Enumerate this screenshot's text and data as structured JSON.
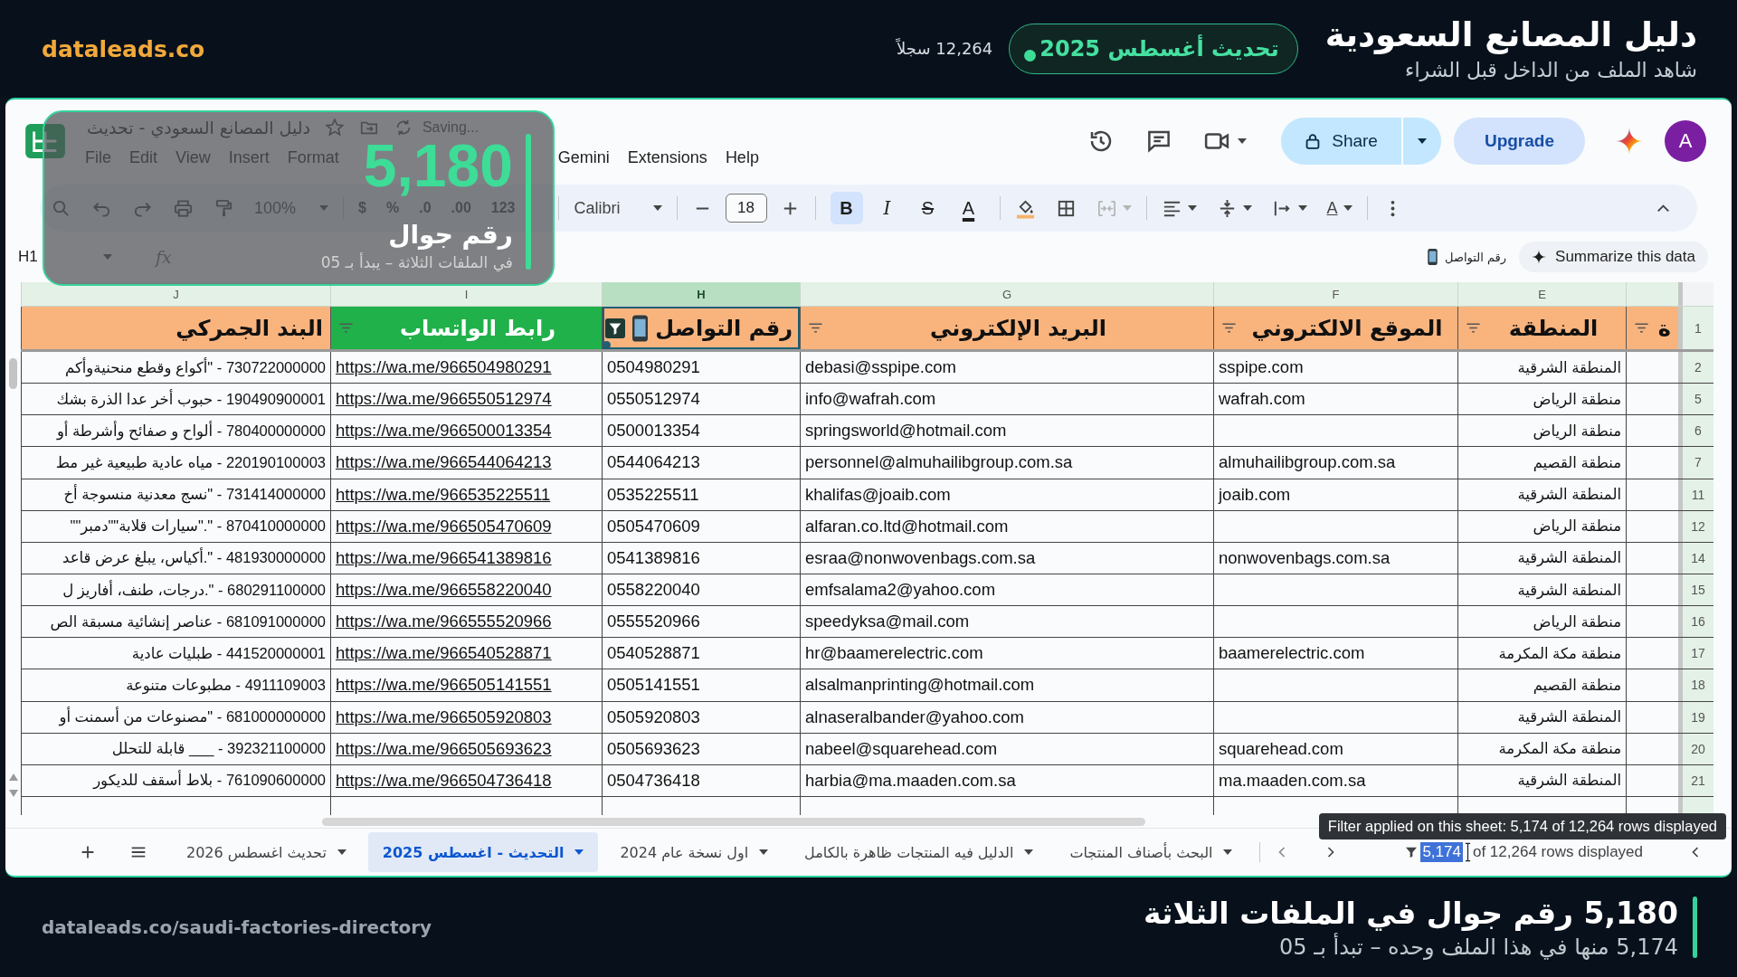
{
  "banner": {
    "brand": "dataleads.co",
    "records": "12,264 سجلاً",
    "badge": "تحديث أغسطس 2025",
    "title": "دليل المصانع السعودية",
    "subtitle": "شاهد الملف من الداخل قبل الشراء"
  },
  "overlay": {
    "number": "5,180",
    "label": "رقم جوال",
    "note": "في الملفات الثلاثة – يبدأ بـ 05"
  },
  "sheet": {
    "title": "دليل المصانع السعودي - تحديث",
    "status": "Saving...",
    "menu": [
      "Help",
      "Extensions",
      "Gemini",
      "Format",
      "Insert",
      "View",
      "Edit",
      "File"
    ],
    "share": "Share",
    "upgrade": "Upgrade",
    "avatar": "A",
    "toolbar": {
      "zoom": "100%",
      "number_formats": [
        "123",
        ".00",
        ".0",
        "%",
        "$"
      ],
      "font": "Calibri",
      "font_size": "18",
      "styles": [
        {
          "kind": "italic",
          "label": "I",
          "selected": false
        },
        {
          "kind": "bold",
          "label": "B",
          "selected": true
        }
      ],
      "strikethrough": "S",
      "text_color": "A",
      "merge_disabled": true,
      "rotation": "A"
    },
    "formula_bar": {
      "name_box": "H1",
      "fx": "fx",
      "value": "رقم التواصل",
      "summarize": "Summarize this data"
    },
    "grid": {
      "header_row": "1",
      "columns": [
        {
          "kind": "partial",
          "header": "ة",
          "filter": true,
          "filtered": false,
          "color": "#f9b47e",
          "selected": false
        },
        {
          "letter": "E",
          "kind": "region",
          "header": "المنطقة",
          "filter": true,
          "filtered": false,
          "color": "#f9b47e",
          "selected": false
        },
        {
          "letter": "F",
          "kind": "website",
          "header": "الموقع الالكتروني",
          "filter": true,
          "filtered": false,
          "color": "#f9b47e",
          "selected": false
        },
        {
          "letter": "G",
          "kind": "email",
          "header": "البريد الإلكتروني",
          "filter": true,
          "filtered": false,
          "color": "#f9b47e",
          "selected": false
        },
        {
          "letter": "H",
          "kind": "phone",
          "header": "رقم التواصل",
          "filter": true,
          "filtered": true,
          "color": "#f9b47e",
          "selected": true
        },
        {
          "letter": "I",
          "kind": "whatsapp",
          "header": "رابط الواتساب",
          "filter": true,
          "filtered": false,
          "color": "#21b14b",
          "selected": false
        },
        {
          "letter": "J",
          "kind": "tariff",
          "header": "البند الجمركي",
          "filter": false,
          "color": "#f9b47e",
          "selected": false
        }
      ],
      "rows": [
        {
          "number": "2",
          "region": "المنطقة الشرقية",
          "website": "sspipe.com",
          "email": "debasi@sspipe.com",
          "phone": "0504980291",
          "whatsapp": "https://wa.me/966504980291",
          "tariff": "730722000000 - \"أكواع وقطع منحنيةوأكم"
        },
        {
          "number": "5",
          "region": "منطقة الرياض",
          "website": "wafrah.com",
          "email": "info@wafrah.com",
          "phone": "0550512974",
          "whatsapp": "https://wa.me/966550512974",
          "tariff": "190490900001 - حبوب أخر عدا الذرة بشك"
        },
        {
          "number": "6",
          "region": "منطقة الرياض",
          "email": "springsworld@hotmail.com",
          "phone": "0500013354",
          "whatsapp": "https://wa.me/966500013354",
          "tariff": "780400000000 - ألواح و صفائح وأشرطة أو"
        },
        {
          "number": "7",
          "region": "منطقة القصيم",
          "website": "almuhailibgroup.com.sa",
          "email": "personnel@almuhailibgroup.com.sa",
          "phone": "0544064213",
          "whatsapp": "https://wa.me/966544064213",
          "tariff": "220190100003 - مياه عادية طبيعية غير مط"
        },
        {
          "number": "11",
          "region": "المنطقة الشرقية",
          "website": "joaib.com",
          "email": "khalifas@joaib.com",
          "phone": "0535225511",
          "whatsapp": "https://wa.me/966535225511",
          "tariff": "731414000000 - \"نسج معدنية منسوجة أخ"
        },
        {
          "number": "12",
          "region": "منطقة الرياض",
          "email": "alfaran.co.ltd@hotmail.com",
          "phone": "0505470609",
          "whatsapp": "https://wa.me/966505470609",
          "tariff": "870410000000 - \".\"سيارات قلابة\"\"دمبر\"\""
        },
        {
          "number": "14",
          "region": "المنطقة الشرقية",
          "website": "nonwovenbags.com.sa",
          "email": "esraa@nonwovenbags.com.sa",
          "phone": "0541389816",
          "whatsapp": "https://wa.me/966541389816",
          "tariff": "481930000000 - \".أكياس، يبلغ عرض قاعد"
        },
        {
          "number": "15",
          "region": "المنطقة الشرقية",
          "email": "emfsalama2@yahoo.com",
          "phone": "0558220040",
          "whatsapp": "https://wa.me/966558220040",
          "tariff": "680291100000 - \".درجات، طنف، أفاريز ل"
        },
        {
          "number": "16",
          "region": "منطقة الرياض",
          "email": "speedyksa@mail.com",
          "phone": "0555520966",
          "whatsapp": "https://wa.me/966555520966",
          "tariff": "681091000000 - عناصر إنشائية مسبقة الص"
        },
        {
          "number": "17",
          "region": "منطقة مكة المكرمة",
          "website": "baamerelectric.com",
          "email": "hr@baamerelectric.com",
          "phone": "0540528871",
          "whatsapp": "https://wa.me/966540528871",
          "tariff": "441520000001 - طبليات  عادية"
        },
        {
          "number": "18",
          "region": "منطقة القصيم",
          "email": "alsalmanprinting@hotmail.com",
          "phone": "0505141551",
          "whatsapp": "https://wa.me/966505141551",
          "tariff": "4911109003 - مطبوعات متنوعة"
        },
        {
          "number": "19",
          "region": "المنطقة الشرقية",
          "email": "alnaseralbander@yahoo.com",
          "phone": "0505920803",
          "whatsapp": "https://wa.me/966505920803",
          "tariff": "681000000000 - \"مصنوعات من أسمنت أو"
        },
        {
          "number": "20",
          "region": "منطقة مكة المكرمة",
          "website": "squarehead.com",
          "email": "nabeel@squarehead.com",
          "phone": "0505693623",
          "whatsapp": "https://wa.me/966505693623",
          "tariff": "392321100000 - ___ قابلة  للتحلل"
        },
        {
          "number": "21",
          "region": "المنطقة الشرقية",
          "website": "ma.maaden.com.sa",
          "email": "harbia@ma.maaden.com.sa",
          "phone": "0504736418",
          "whatsapp": "https://wa.me/966504736418",
          "tariff": "761090600000 - بلاط أسقف  للديكور"
        }
      ]
    },
    "tabs": [
      {
        "label": "البحث بأصناف المنتجات",
        "selected": false
      },
      {
        "label": "الدليل فيه المنتجات ظاهرة بالكامل",
        "selected": false
      },
      {
        "label": "اول نسخة عام 2024",
        "selected": false
      },
      {
        "label": "التحديث - اغسطس 2025",
        "selected": true
      },
      {
        "label": "تحديث اغسطس 2026",
        "selected": false
      }
    ],
    "rows_status": {
      "count": "5,174",
      "count_selected": true,
      "text": "of 12,264 rows displayed"
    },
    "tooltip": "Filter applied on this sheet: 5,174 of 12,264 rows displayed"
  },
  "footer": {
    "url": "dataleads.co/saudi-factories-directory",
    "headline": "5,180 رقم جوال في الملفات الثلاثة",
    "subline": "5,174 منها في هذا الملف وحده – تبدأ بـ 05"
  }
}
